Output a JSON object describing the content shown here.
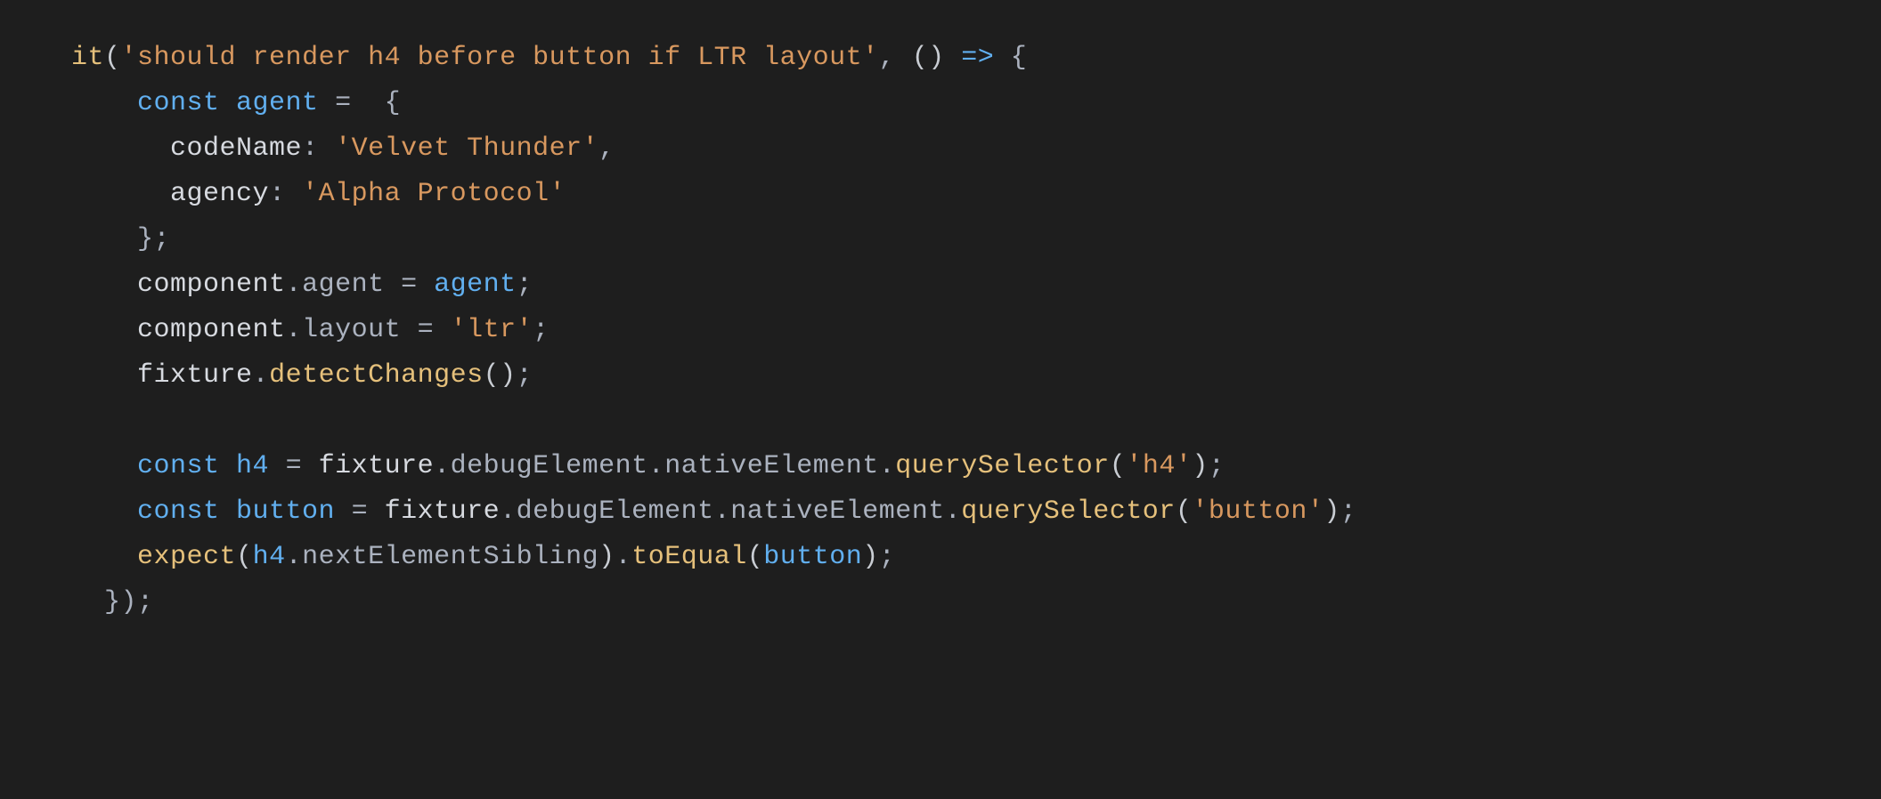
{
  "code": {
    "fn_it": "it",
    "str_test_name": "'should render h4 before button if LTR layout'",
    "arrow": "=>",
    "kw_const": "const",
    "id_agent": "agent",
    "prop_codeName": "codeName",
    "str_velvet": "'Velvet Thunder'",
    "prop_agency": "agency",
    "str_alpha": "'Alpha Protocol'",
    "id_component": "component",
    "prop_agent": "agent",
    "prop_layout": "layout",
    "str_ltr": "'ltr'",
    "id_fixture": "fixture",
    "m_detectChanges": "detectChanges",
    "id_h4": "h4",
    "p_debugElement": "debugElement",
    "p_nativeElement": "nativeElement",
    "m_querySelector": "querySelector",
    "str_h4": "'h4'",
    "id_button": "button",
    "str_button": "'button'",
    "fn_expect": "expect",
    "p_nextElementSibling": "nextElementSibling",
    "m_toEqual": "toEqual"
  }
}
